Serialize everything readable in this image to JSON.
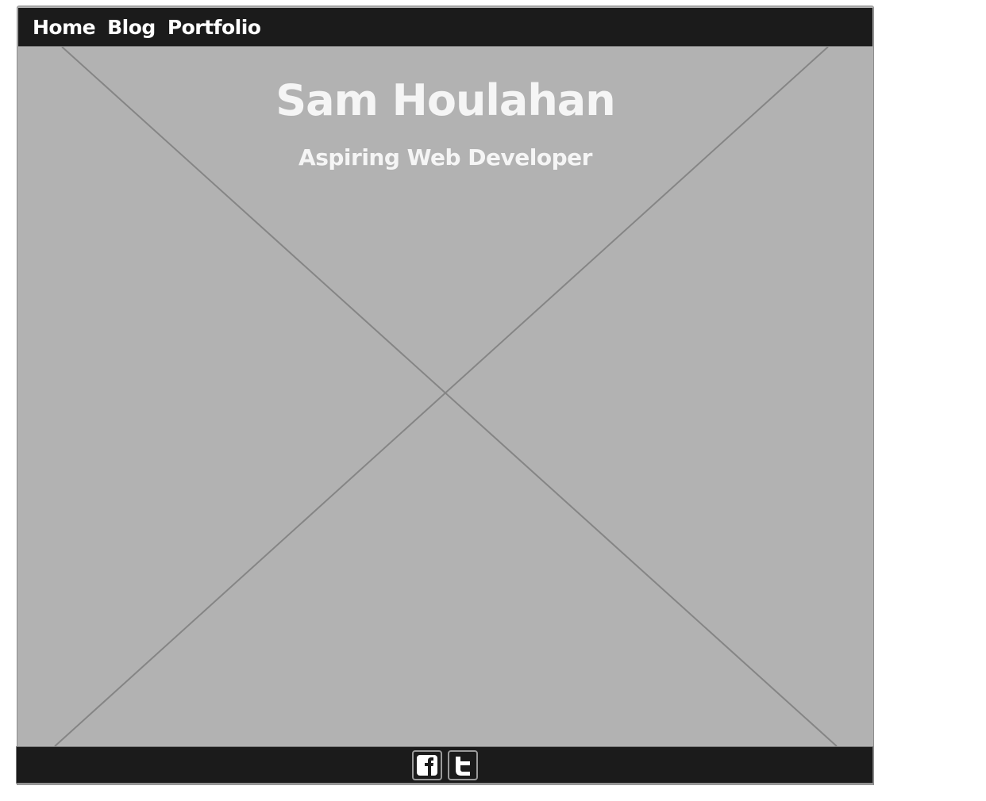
{
  "nav": {
    "items": [
      {
        "label": "Home"
      },
      {
        "label": "Blog"
      },
      {
        "label": "Portfolio"
      }
    ]
  },
  "hero": {
    "title": "Sam Houlahan",
    "subtitle": "Aspiring Web Developer",
    "placeholder_icon": "image-placeholder-cross"
  },
  "footer": {
    "social": [
      {
        "icon": "facebook-icon"
      },
      {
        "icon": "twitter-icon"
      }
    ]
  },
  "colors": {
    "nav_bg": "#1b1b1b",
    "hero_bg": "#b2b2b2",
    "text": "#f5f5f5"
  }
}
